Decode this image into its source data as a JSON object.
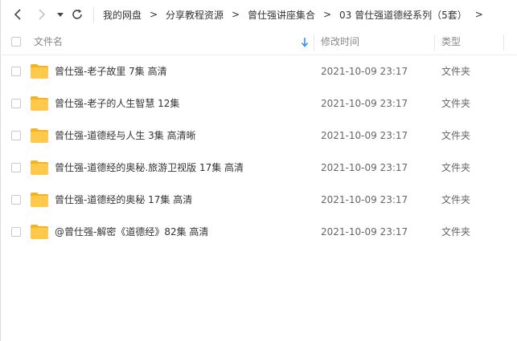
{
  "toolbar": {
    "back_icon": "chevron-left-icon",
    "forward_icon": "chevron-right-icon",
    "history_icon": "caret-down-icon",
    "refresh_icon": "refresh-icon"
  },
  "breadcrumbs": [
    "我的网盘",
    "分享教程资源",
    "曾仕强讲座集合",
    "03 曾仕强道德经系列（5套）"
  ],
  "breadcrumb_separator": ">",
  "columns": {
    "name": "文件名",
    "modified": "修改时间",
    "type": "类型",
    "sort_icon": "arrow-down-icon"
  },
  "files": [
    {
      "name": "曾仕强-老子故里 7集 高清",
      "modified": "2021-10-09 23:17",
      "type": "文件夹"
    },
    {
      "name": "曾仕强-老子的人生智慧 12集",
      "modified": "2021-10-09 23:17",
      "type": "文件夹"
    },
    {
      "name": "曾仕强-道德经与人生 3集 高清晰",
      "modified": "2021-10-09 23:17",
      "type": "文件夹"
    },
    {
      "name": "曾仕强-道德经的奥秘.旅游卫视版 17集 高清",
      "modified": "2021-10-09 23:17",
      "type": "文件夹"
    },
    {
      "name": "曾仕强-道德经的奥秘 17集 高清",
      "modified": "2021-10-09 23:17",
      "type": "文件夹"
    },
    {
      "name": "@曾仕强-解密《道德经》82集  高清",
      "modified": "2021-10-09 23:17",
      "type": "文件夹"
    }
  ],
  "colors": {
    "folder": "#ffc94d",
    "folder_tab": "#f5b41e",
    "sort_arrow": "#3b8ff0",
    "header_text": "#888888"
  }
}
